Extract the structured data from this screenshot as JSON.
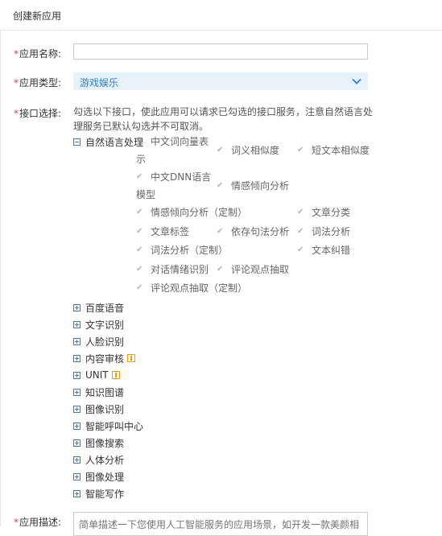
{
  "header": {
    "title": "创建新应用"
  },
  "form": {
    "app_name": {
      "label": "应用名称:",
      "value": "",
      "placeholder": ""
    },
    "app_type": {
      "label": "应用类型:",
      "value": "游戏娱乐"
    },
    "api_select": {
      "label": "接口选择:",
      "line1": "勾选以下接口，使此应用可以请求已勾选的接口服务，注意自然语言处",
      "line2": "理服务已默认勾选并不可取消。"
    },
    "app_desc": {
      "label": "应用描述:",
      "placeholder": "简单描述一下您使用人工智能服务的应用场景，如开发一款美颜相"
    }
  },
  "tree": {
    "nlp": {
      "label": "自然语言处理",
      "items": {
        "word_vec_1": "中文词向量表",
        "word_vec_2": "示",
        "word_sim": "词义相似度",
        "short_text_sim": "短文本相似度",
        "dnn_1": "中文DNN语言",
        "dnn_2": "模型",
        "sentiment": "情感倾向分析",
        "sentiment_custom": "情感倾向分析（定制）",
        "article_class": "文章分类",
        "article_tag": "文章标签",
        "dep_parse": "依存句法分析",
        "lexer": "词法分析",
        "lexer_custom": "词法分析（定制）",
        "correction": "文本纠错",
        "emotion": "对话情绪识别",
        "comment_tag": "评论观点抽取",
        "comment_tag_custom": "评论观点抽取（定制）"
      }
    },
    "baidu_speech": "百度语音",
    "ocr": "文字识别",
    "face": "人脸识别",
    "content_audit": "内容审核",
    "unit": "UNIT",
    "kg": "知识图谱",
    "image_recog": "图像识别",
    "call_center": "智能呼叫中心",
    "image_search": "图像搜索",
    "body": "人体分析",
    "image_process": "图像处理",
    "writing": "智能写作"
  }
}
